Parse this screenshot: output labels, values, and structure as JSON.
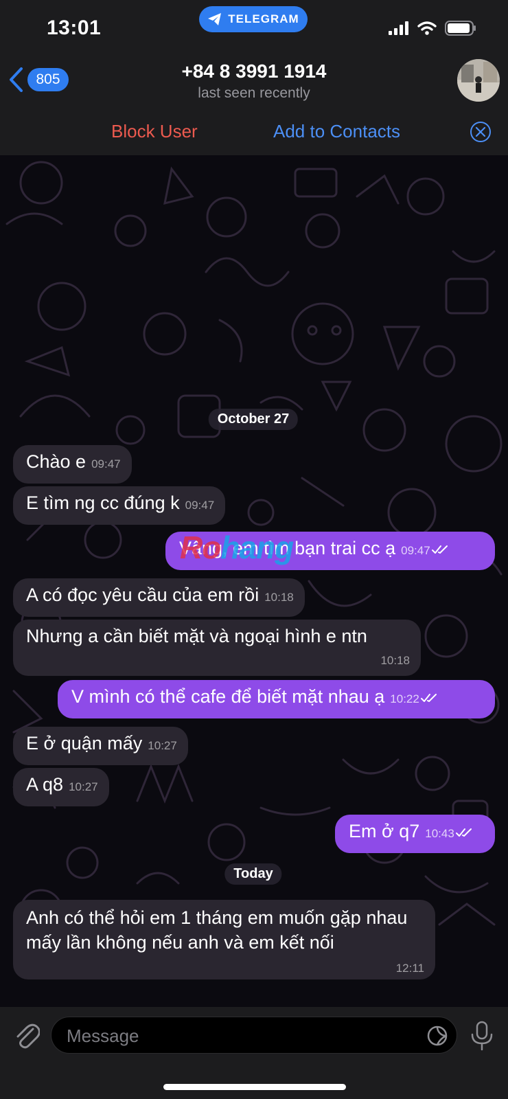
{
  "status_bar": {
    "time": "13:01",
    "app_pill": "TELEGRAM"
  },
  "header": {
    "back_count": "805",
    "title": "+84 8 3991 1914",
    "subtitle": "last seen recently"
  },
  "action_bar": {
    "block": "Block User",
    "add": "Add to Contacts"
  },
  "dates": {
    "first": "October 27",
    "second": "Today"
  },
  "messages": [
    {
      "text": "Chào e",
      "time": "09:47",
      "dir": "in"
    },
    {
      "text": "E tìm ng cc đúng k",
      "time": "09:47",
      "dir": "in"
    },
    {
      "text": "Vâng, em tìm bạn trai cc ạ",
      "time": "09:47",
      "dir": "out"
    },
    {
      "text": "A có đọc yêu cầu của em rồi",
      "time": "10:18",
      "dir": "in"
    },
    {
      "text": "Nhưng a cần biết mặt và ngoại hình e ntn",
      "time": "10:18",
      "dir": "in"
    },
    {
      "text": "V mình có thể cafe để biết mặt nhau ạ",
      "time": "10:22",
      "dir": "out"
    },
    {
      "text": "E ở quận mấy",
      "time": "10:27",
      "dir": "in"
    },
    {
      "text": "A q8",
      "time": "10:27",
      "dir": "in"
    },
    {
      "text": "Em ở q7",
      "time": "10:43",
      "dir": "out"
    },
    {
      "text": "Anh có thể hỏi em 1 tháng em muốn gặp nhau mấy lần không nếu anh và em kết nối",
      "time": "12:11",
      "dir": "in"
    }
  ],
  "watermark": {
    "a": "Ro",
    "b": "hang"
  },
  "composer": {
    "placeholder": "Message"
  },
  "colors": {
    "accent": "#2f7df0",
    "outgoing": "#8e4be8",
    "incoming": "#2a2630",
    "danger": "#ec5a4f"
  },
  "icons": [
    "back-chevron-icon",
    "telegram-plane-icon",
    "signal-icon",
    "wifi-icon",
    "battery-icon",
    "close-circle-icon",
    "double-check-icon",
    "paperclip-icon",
    "sticker-icon",
    "microphone-icon"
  ]
}
